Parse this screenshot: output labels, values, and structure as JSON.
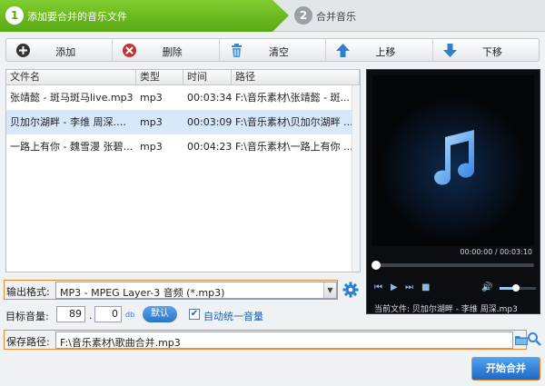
{
  "steps": [
    {
      "num": "1",
      "label": "添加要合并的音乐文件"
    },
    {
      "num": "2",
      "label": "合并音乐"
    }
  ],
  "toolbar": {
    "add": "添加",
    "delete": "删除",
    "clear": "清空",
    "move_up": "上移",
    "move_down": "下移"
  },
  "list": {
    "columns": [
      "文件名",
      "类型",
      "时间",
      "路径"
    ],
    "rows": [
      {
        "name": "张靖懿 - 斑马斑马live.mp3",
        "type": "mp3",
        "time": "00:03:34",
        "path": "F:\\音乐素材\\张靖懿 - 斑...",
        "selected": false
      },
      {
        "name": "贝加尔湖畔 - 李维 周深.…",
        "type": "mp3",
        "time": "00:03:09",
        "path": "F:\\音乐素材\\贝加尔湖畔 ...",
        "selected": true
      },
      {
        "name": "一路上有你 - 魏雪漫 张碧…",
        "type": "mp3",
        "time": "00:04:23",
        "path": "F:\\音乐素材\\一路上有你 ...",
        "selected": false
      }
    ]
  },
  "player": {
    "timecode": "00:00:00 / 00:03:10",
    "current_file": "当前文件: 贝加尔湖畔 - 李维 周深.mp3",
    "progress": 0,
    "volume": 0.45
  },
  "settings": {
    "format_label": "输出格式:",
    "format_value": "MP3 - MPEG Layer-3 音频 (*.mp3)",
    "volume_label": "目标音量:",
    "volume_int": "89",
    "volume_dot": ".",
    "volume_dec": "0",
    "volume_unit": "db",
    "default_btn": "默认",
    "auto_label": "自动统一音量",
    "auto_checked": true,
    "save_label": "保存路径:",
    "save_path": "F:\\音乐素材\\歌曲合并.mp3"
  },
  "start_btn": "开始合并",
  "colors": {
    "step_active": "#5aa815",
    "accent_blue": "#2a74c7",
    "highlight": "#e8892b"
  }
}
